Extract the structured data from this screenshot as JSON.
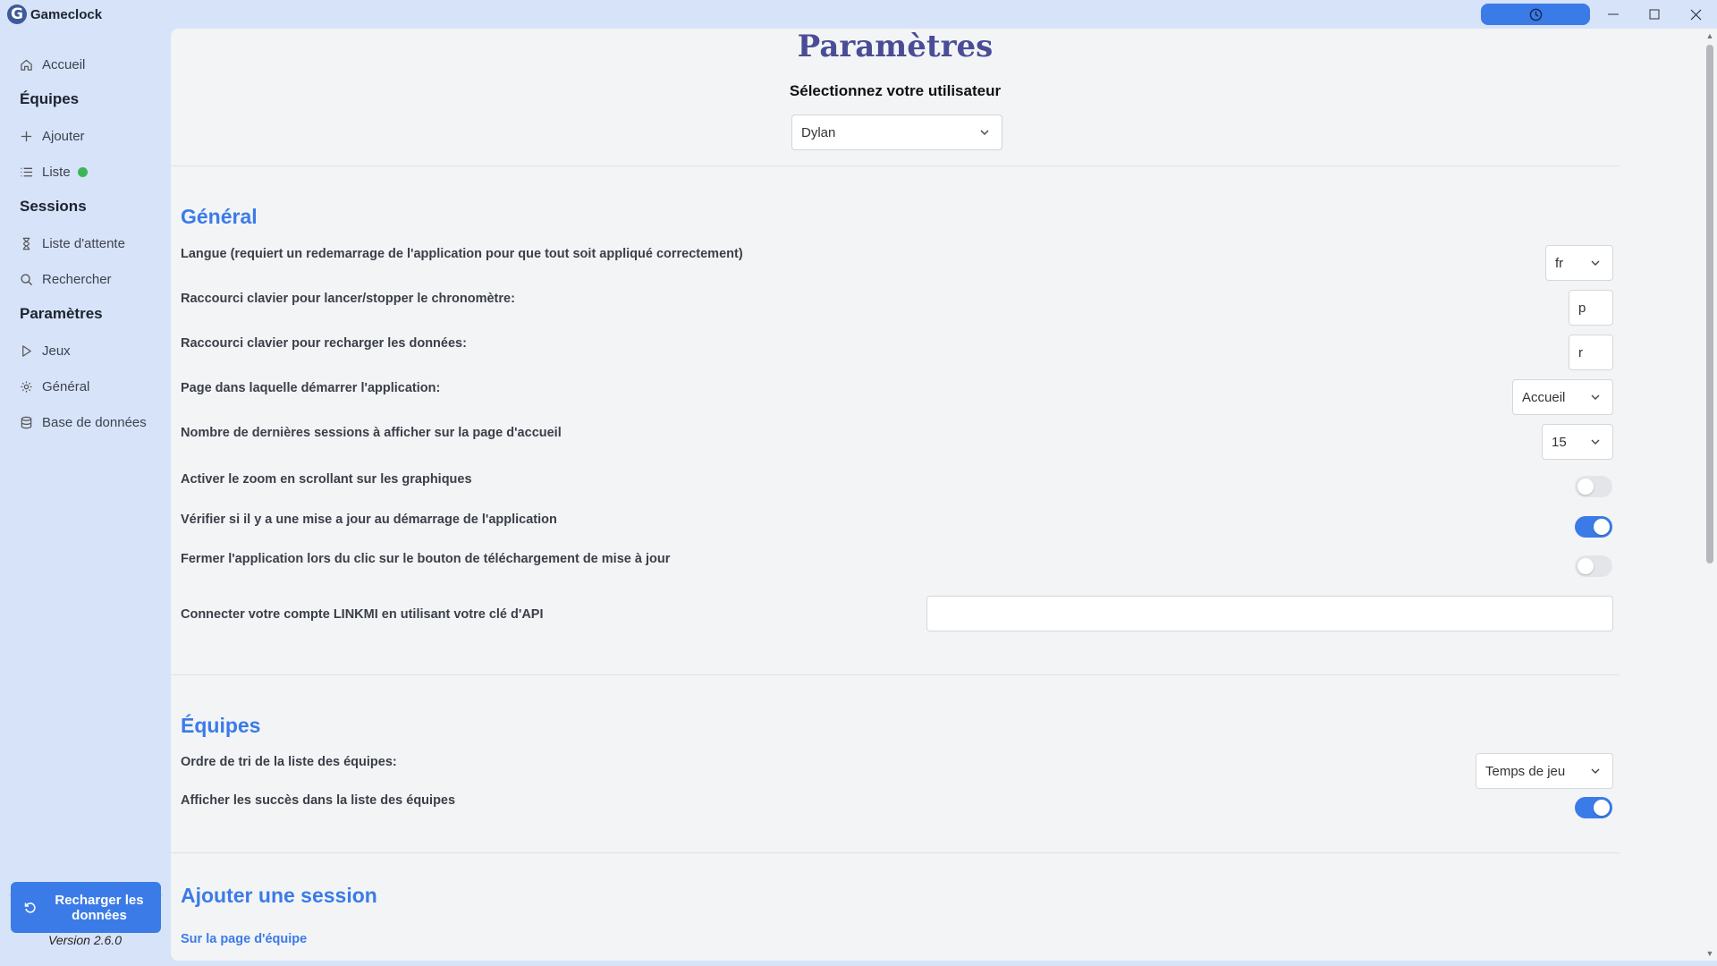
{
  "app": {
    "logo_letter": "G",
    "title": "Gameclock"
  },
  "sidebar": {
    "home": "Accueil",
    "teams_heading": "Équipes",
    "teams_add": "Ajouter",
    "teams_list": "Liste",
    "sessions_heading": "Sessions",
    "sessions_queue": "Liste d'attente",
    "sessions_search": "Rechercher",
    "settings_heading": "Paramètres",
    "settings_games": "Jeux",
    "settings_general": "Général",
    "settings_database": "Base de données",
    "reload_button": "Recharger les données",
    "version": "Version 2.6.0"
  },
  "main": {
    "title": "Paramètres",
    "select_user_label": "Sélectionnez votre utilisateur",
    "selected_user": "Dylan",
    "general": {
      "title": "Général",
      "language_label": "Langue (requiert un redemarrage de l'application pour que tout soit appliqué correctement)",
      "language_value": "fr",
      "shortcut_timer_label": "Raccourci clavier pour lancer/stopper le chronomètre:",
      "shortcut_timer_value": "p",
      "shortcut_reload_label": "Raccourci clavier pour recharger les données:",
      "shortcut_reload_value": "r",
      "start_page_label": "Page dans laquelle démarrer l'application:",
      "start_page_value": "Accueil",
      "last_sessions_label": "Nombre de dernières sessions à afficher sur la page d'accueil",
      "last_sessions_value": "15",
      "zoom_label": "Activer le zoom en scrollant sur les graphiques",
      "zoom_enabled": false,
      "update_check_label": "Vérifier si il y a une mise a jour au démarrage de l'application",
      "update_check_enabled": true,
      "close_on_update_label": "Fermer l'application lors du clic sur le bouton de téléchargement de mise à jour",
      "close_on_update_enabled": false,
      "linkmi_label": "Connecter votre compte LINKMI en utilisant votre clé d'API",
      "linkmi_value": ""
    },
    "teams": {
      "title": "Équipes",
      "sort_label": "Ordre de tri de la liste des équipes:",
      "sort_value": "Temps de jeu",
      "show_achievements_label": "Afficher les succès dans la liste des équipes",
      "show_achievements_enabled": true
    },
    "add_session": {
      "title": "Ajouter une session",
      "subsection": "Sur la page d'équipe"
    }
  },
  "colors": {
    "accent": "#3b7be8",
    "title": "#4a4d96",
    "background": "#d7e3f8",
    "panel": "#f3f4f6",
    "status_dot": "#3cb45a"
  }
}
